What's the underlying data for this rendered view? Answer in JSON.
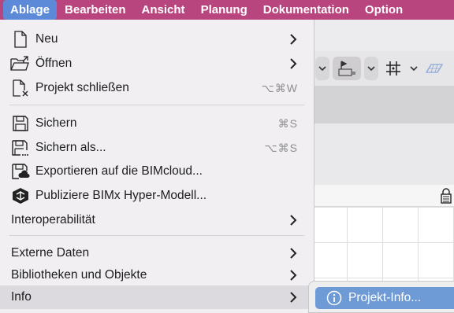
{
  "menubar": {
    "items": [
      "Ablage",
      "Bearbeiten",
      "Ansicht",
      "Planung",
      "Dokumentation",
      "Option"
    ]
  },
  "menu": {
    "items": {
      "neu": {
        "label": "Neu",
        "icon": "new-document-icon"
      },
      "oeffnen": {
        "label": "Öffnen",
        "icon": "open-folder-icon"
      },
      "schliessen": {
        "label": "Projekt schließen",
        "shortcut": "⌥⌘W",
        "icon": "close-document-icon"
      },
      "sichern": {
        "label": "Sichern",
        "shortcut": "⌘S",
        "icon": "save-icon"
      },
      "sichern_als": {
        "label": "Sichern als...",
        "shortcut": "⌥⌘S",
        "icon": "save-as-icon"
      },
      "exportieren": {
        "label": "Exportieren auf die BIMcloud...",
        "icon": "bimcloud-export-icon"
      },
      "publiziere": {
        "label": "Publiziere BIMx Hyper-Modell...",
        "icon": "bimx-publish-icon"
      },
      "interop": {
        "label": "Interoperabilität"
      },
      "externe": {
        "label": "Externe Daten"
      },
      "bibliotheken": {
        "label": "Bibliotheken und Objekte"
      },
      "info": {
        "label": "Info"
      }
    }
  },
  "submenu": {
    "projekt_info": {
      "label": "Projekt-Info...",
      "icon": "info-circle-icon"
    }
  },
  "colors": {
    "menubar": "#b9457e",
    "active_menu": "#5c89d8",
    "highlight": "#6e9ad6"
  }
}
